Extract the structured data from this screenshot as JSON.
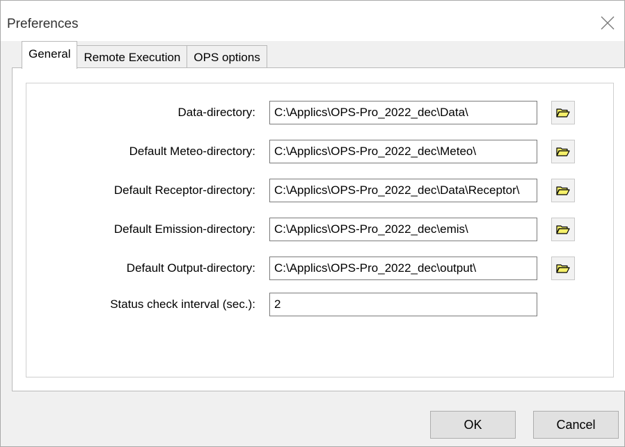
{
  "window": {
    "title": "Preferences"
  },
  "tabs": [
    {
      "label": "General",
      "active": true
    },
    {
      "label": "Remote Execution",
      "active": false
    },
    {
      "label": "OPS options",
      "active": false
    }
  ],
  "fields": [
    {
      "label": "Data-directory:",
      "value": "C:\\Applics\\OPS-Pro_2022_dec\\Data\\",
      "browse": true
    },
    {
      "label": "Default Meteo-directory:",
      "value": "C:\\Applics\\OPS-Pro_2022_dec\\Meteo\\",
      "browse": true
    },
    {
      "label": "Default Receptor-directory:",
      "value": "C:\\Applics\\OPS-Pro_2022_dec\\Data\\Receptor\\",
      "browse": true
    },
    {
      "label": "Default Emission-directory:",
      "value": "C:\\Applics\\OPS-Pro_2022_dec\\emis\\",
      "browse": true
    },
    {
      "label": "Default Output-directory:",
      "value": "C:\\Applics\\OPS-Pro_2022_dec\\output\\",
      "browse": true
    },
    {
      "label": "Status check interval (sec.):",
      "value": "2",
      "browse": false
    }
  ],
  "buttons": {
    "ok": "OK",
    "cancel": "Cancel"
  },
  "icons": {
    "close": "close-icon",
    "browse": "folder-open-icon"
  },
  "colors": {
    "folder_fill": "#f5f06a",
    "folder_stroke": "#000000"
  }
}
